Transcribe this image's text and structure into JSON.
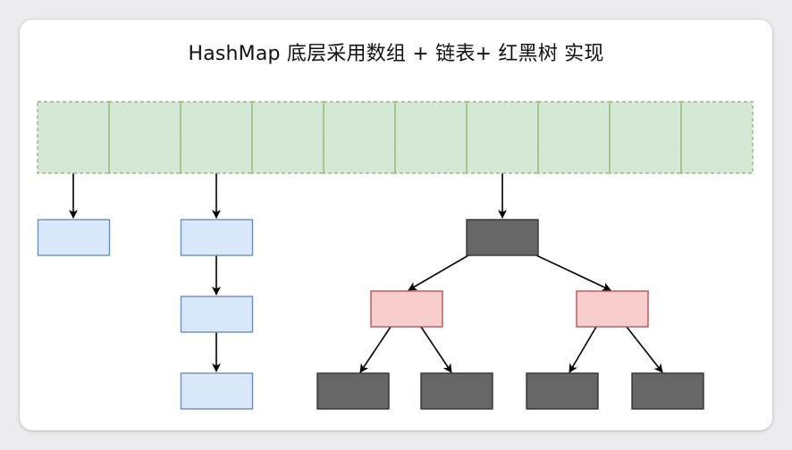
{
  "title": "HashMap 底层采用数组 + 链表+ 红黑树 实现",
  "colors": {
    "array_fill": "#d5e8d4",
    "array_stroke": "#82b366",
    "list_fill": "#dae8fc",
    "list_stroke": "#6c8ebf",
    "red_fill": "#f8cecc",
    "red_stroke": "#b85450",
    "black_fill": "#666666",
    "black_stroke": "#333333",
    "arrow": "#000000"
  },
  "array": {
    "bucket_count": 10
  },
  "linked_lists": [
    {
      "bucket": 0,
      "node_count": 1
    },
    {
      "bucket": 2,
      "node_count": 3
    }
  ],
  "red_black_tree": {
    "bucket": 6,
    "root_color": "black",
    "children_color": "red",
    "leaf_color": "black"
  }
}
